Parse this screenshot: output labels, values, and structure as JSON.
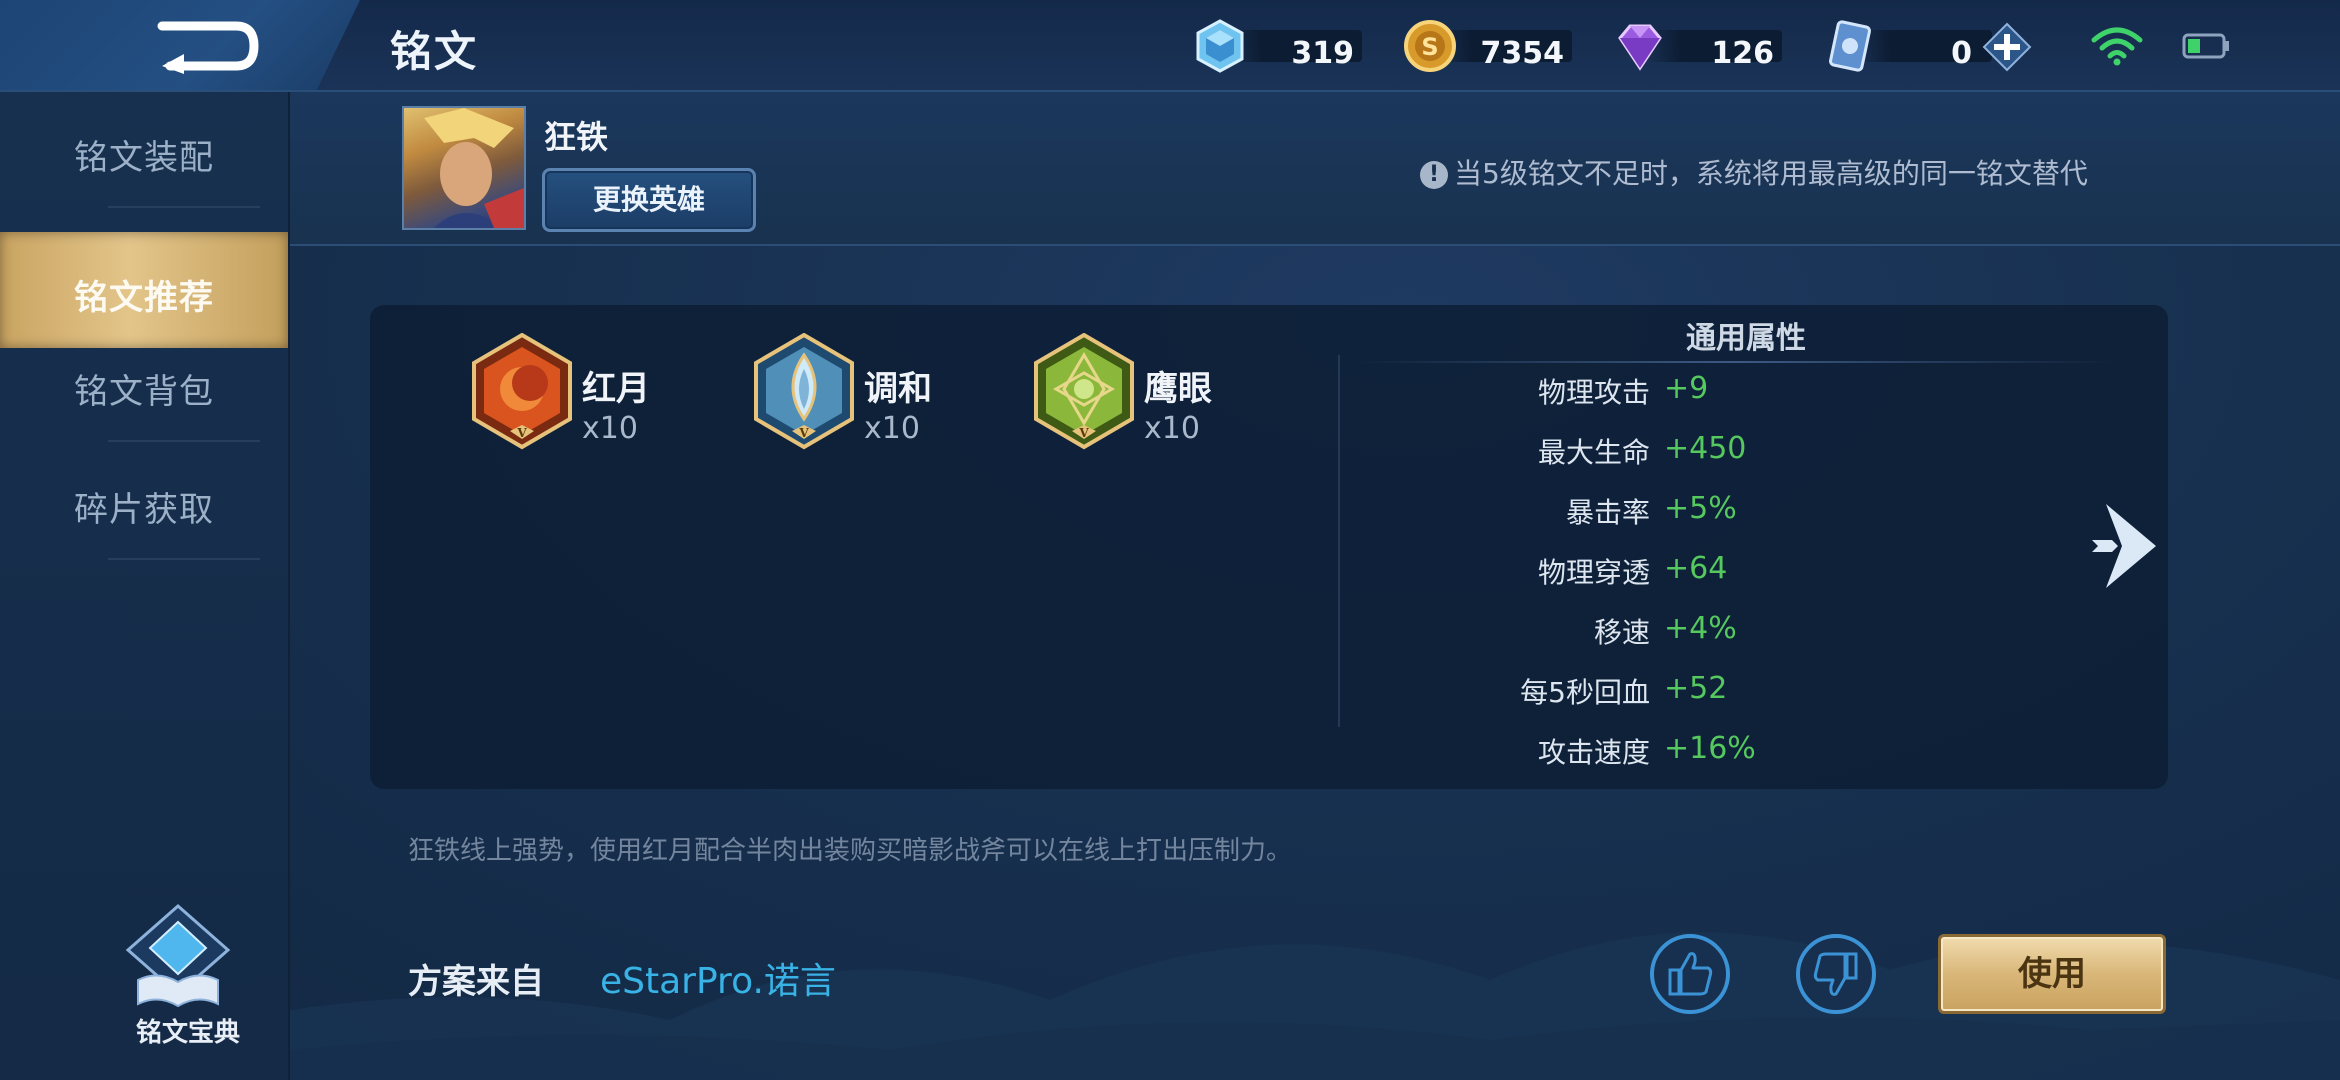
{
  "topbar": {
    "title": "铭文",
    "currencies": [
      {
        "name": "diamond-crystal",
        "value": "319"
      },
      {
        "name": "gold-coin",
        "value": "7354"
      },
      {
        "name": "purple-gem",
        "value": "126"
      },
      {
        "name": "voucher-card",
        "value": "0"
      }
    ]
  },
  "sidebar": {
    "items": [
      {
        "label": "铭文装配",
        "active": false
      },
      {
        "label": "铭文推荐",
        "active": true
      },
      {
        "label": "铭文背包",
        "active": false
      },
      {
        "label": "碎片获取",
        "active": false
      }
    ],
    "codex_label": "铭文宝典"
  },
  "hero": {
    "name": "狂铁",
    "change_label": "更换英雄"
  },
  "notice": "当5级铭文不足时，系统将用最高级的同一铭文替代",
  "runes": [
    {
      "name": "红月",
      "count": "x10",
      "color": "#d9541f",
      "level": "V"
    },
    {
      "name": "调和",
      "count": "x10",
      "color": "#7fb4d8",
      "level": "V"
    },
    {
      "name": "鹰眼",
      "count": "x10",
      "color": "#8bb83a",
      "level": "V"
    }
  ],
  "attributes": {
    "title": "通用属性",
    "rows": [
      {
        "key": "物理攻击",
        "value": "+9"
      },
      {
        "key": "最大生命",
        "value": "+450"
      },
      {
        "key": "暴击率",
        "value": "+5%"
      },
      {
        "key": "物理穿透",
        "value": "+64"
      },
      {
        "key": "移速",
        "value": "+4%"
      },
      {
        "key": "每5秒回血",
        "value": "+52"
      },
      {
        "key": "攻击速度",
        "value": "+16%"
      }
    ]
  },
  "description": "狂铁线上强势，使用红月配合半肉出装购买暗影战斧可以在线上打出压制力。",
  "source": {
    "label": "方案来自",
    "author": "eStarPro.诺言"
  },
  "actions": {
    "use_label": "使用"
  },
  "colors": {
    "accent_gold": "#d9b779",
    "link_blue": "#39b2e6",
    "stat_green": "#55c85e"
  }
}
